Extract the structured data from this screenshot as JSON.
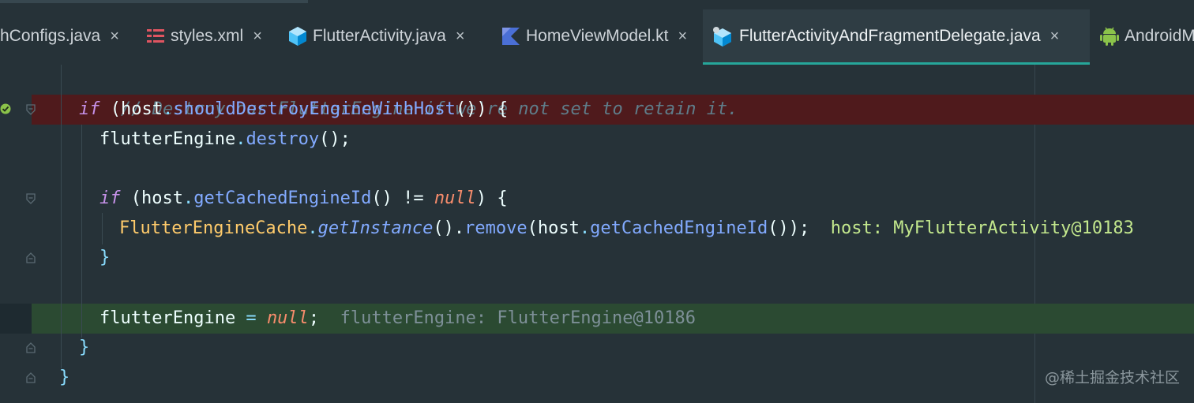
{
  "tabs": [
    {
      "label": "hConfigs.java",
      "icon": "java-file-icon",
      "active": false
    },
    {
      "label": "styles.xml",
      "icon": "xml-file-icon",
      "active": false
    },
    {
      "label": "FlutterActivity.java",
      "icon": "flutter-class-icon",
      "active": false
    },
    {
      "label": "HomeViewModel.kt",
      "icon": "kotlin-file-icon",
      "active": false
    },
    {
      "label": "FlutterActivityAndFragmentDelegate.java",
      "icon": "flutter-class-icon",
      "active": true
    },
    {
      "label": "AndroidM",
      "icon": "android-icon",
      "active": false
    }
  ],
  "close_glyph": "×",
  "code": {
    "l1_comment": "// Destroy our FlutterEngine if we're not set to retain it.",
    "l2": {
      "kw": "if",
      "p1": " (",
      "obj": "host",
      "dot": ".",
      "method": "shouldDestroyEngineWithHost",
      "tail": "()) {"
    },
    "l3": {
      "obj": "flutterEngine",
      "dot": ".",
      "method": "destroy",
      "tail": "();"
    },
    "l5": {
      "kw": "if",
      "p1": " (",
      "obj": "host",
      "dot": ".",
      "method": "getCachedEngineId",
      "mid": "() != ",
      "nul": "null",
      "tail": ") {"
    },
    "l6": {
      "cls": "FlutterEngineCache",
      "dot1": ".",
      "static_method": "getInstance",
      "mid1": "().",
      "method": "remove",
      "mid2": "(",
      "obj": "host",
      "dot2": ".",
      "method2": "getCachedEngineId",
      "tail": "());"
    },
    "l6_hint": {
      "var": "host:",
      "value": " MyFlutterActivity@10183"
    },
    "l7": "}",
    "l9": {
      "obj": "flutterEngine",
      "op": " = ",
      "nul": "null",
      "tail": ";"
    },
    "l9_hint": "flutterEngine: FlutterEngine@10186",
    "l10": "}",
    "l11": "}"
  },
  "watermark": "@稀土掘金技术社区",
  "colors": {
    "background": "#263238",
    "breakpoint_line": "#4f1a1c",
    "execution_line": "#2b4a32",
    "active_tab_underline": "#26a69a"
  }
}
